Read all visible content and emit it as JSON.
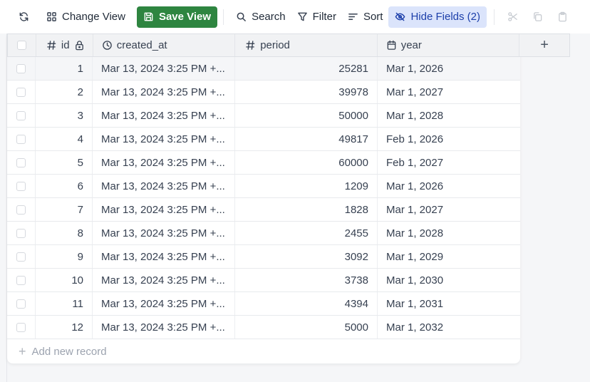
{
  "toolbar": {
    "change_view": "Change View",
    "save_view": "Save View",
    "search": "Search",
    "filter": "Filter",
    "sort": "Sort",
    "hide_fields": "Hide Fields (2)"
  },
  "columns": {
    "id": "id",
    "created_at": "created_at",
    "period": "period",
    "year": "year",
    "add": "+"
  },
  "rows": [
    {
      "id": "1",
      "created_at": "Mar 13, 2024 3:25 PM +...",
      "period": "25281",
      "year": "Mar 1, 2026"
    },
    {
      "id": "2",
      "created_at": "Mar 13, 2024 3:25 PM +...",
      "period": "39978",
      "year": "Mar 1, 2027"
    },
    {
      "id": "3",
      "created_at": "Mar 13, 2024 3:25 PM +...",
      "period": "50000",
      "year": "Mar 1, 2028"
    },
    {
      "id": "4",
      "created_at": "Mar 13, 2024 3:25 PM +...",
      "period": "49817",
      "year": "Feb 1, 2026"
    },
    {
      "id": "5",
      "created_at": "Mar 13, 2024 3:25 PM +...",
      "period": "60000",
      "year": "Feb 1, 2027"
    },
    {
      "id": "6",
      "created_at": "Mar 13, 2024 3:25 PM +...",
      "period": "1209",
      "year": "Mar 1, 2026"
    },
    {
      "id": "7",
      "created_at": "Mar 13, 2024 3:25 PM +...",
      "period": "1828",
      "year": "Mar 1, 2027"
    },
    {
      "id": "8",
      "created_at": "Mar 13, 2024 3:25 PM +...",
      "period": "2455",
      "year": "Mar 1, 2028"
    },
    {
      "id": "9",
      "created_at": "Mar 13, 2024 3:25 PM +...",
      "period": "3092",
      "year": "Mar 1, 2029"
    },
    {
      "id": "10",
      "created_at": "Mar 13, 2024 3:25 PM +...",
      "period": "3738",
      "year": "Mar 1, 2030"
    },
    {
      "id": "11",
      "created_at": "Mar 13, 2024 3:25 PM +...",
      "period": "4394",
      "year": "Mar 1, 2031"
    },
    {
      "id": "12",
      "created_at": "Mar 13, 2024 3:25 PM +...",
      "period": "5000",
      "year": "Mar 1, 2032"
    }
  ],
  "add_record": "Add new record",
  "colors": {
    "save_button": "#2e8540",
    "hide_fields_bg": "#dbe4fb",
    "hide_fields_text": "#1c3faa"
  },
  "icons": {
    "refresh": "refresh-icon",
    "change_view": "grid-icon",
    "save_view": "save-icon",
    "search": "search-icon",
    "filter": "filter-icon",
    "sort": "sort-icon",
    "hide_fields": "eye-off-icon",
    "cut": "scissors-icon",
    "copy": "copy-icon",
    "paste": "clipboard-icon"
  }
}
